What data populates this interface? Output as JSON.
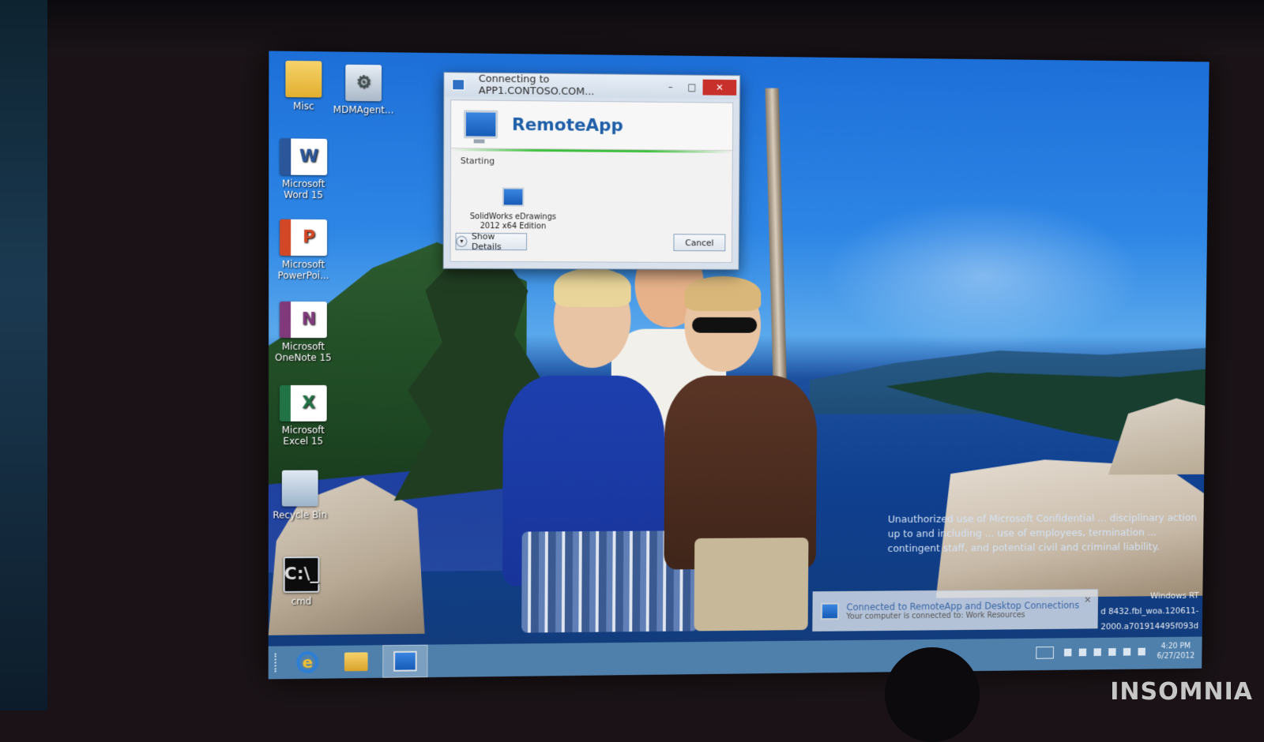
{
  "desktop": {
    "icons": [
      {
        "label": "Misc",
        "icon": "folder-icon"
      },
      {
        "label": "MDMAgent...",
        "icon": "mdm-agent-icon"
      },
      {
        "label": "Microsoft Word 15",
        "icon": "word-icon",
        "glyph": "W"
      },
      {
        "label": "Microsoft PowerPoi...",
        "icon": "powerpoint-icon",
        "glyph": "P"
      },
      {
        "label": "Microsoft OneNote 15",
        "icon": "onenote-icon",
        "glyph": "N"
      },
      {
        "label": "Microsoft Excel 15",
        "icon": "excel-icon",
        "glyph": "X"
      },
      {
        "label": "Recycle Bin",
        "icon": "recycle-bin-icon"
      },
      {
        "label": "cmd",
        "icon": "cmd-icon",
        "glyph": "C:\\_"
      }
    ]
  },
  "dialog": {
    "title": "Connecting to APP1.CONTOSO.COM...",
    "minimize": "–",
    "maximize": "□",
    "close": "✕",
    "banner_title": "RemoteApp",
    "status": "Starting",
    "app_name": "SolidWorks eDrawings 2012 x64 Edition",
    "show_details_label": "Show Details",
    "cancel_label": "Cancel",
    "progress_color": "#3fbf3f"
  },
  "notification": {
    "title": "Connected to RemoteApp and Desktop Connections",
    "subtitle": "Your computer is connected to: Work Resources",
    "close": "✕"
  },
  "legal_text": "Unauthorized use of Microsoft Confidential ... disciplinary action up to and including ... use of employees, termination ... contingent staff, and potential civil and criminal liability.",
  "build_info": {
    "edition": "Windows RT",
    "build": "d 8432.fbl_woa.120611-2000.a701914495f093d"
  },
  "taskbar": {
    "items": [
      {
        "name": "internet-explorer",
        "glyph": "e"
      },
      {
        "name": "file-explorer"
      },
      {
        "name": "remoteapp",
        "active": true
      }
    ],
    "clock": {
      "time": "4:20 PM",
      "date": "6/27/2012"
    }
  },
  "watermark": "INSOMNIA",
  "colors": {
    "accent": "#1f5fa8",
    "close_button": "#c8302b",
    "taskbar": "#5a8cb4"
  }
}
